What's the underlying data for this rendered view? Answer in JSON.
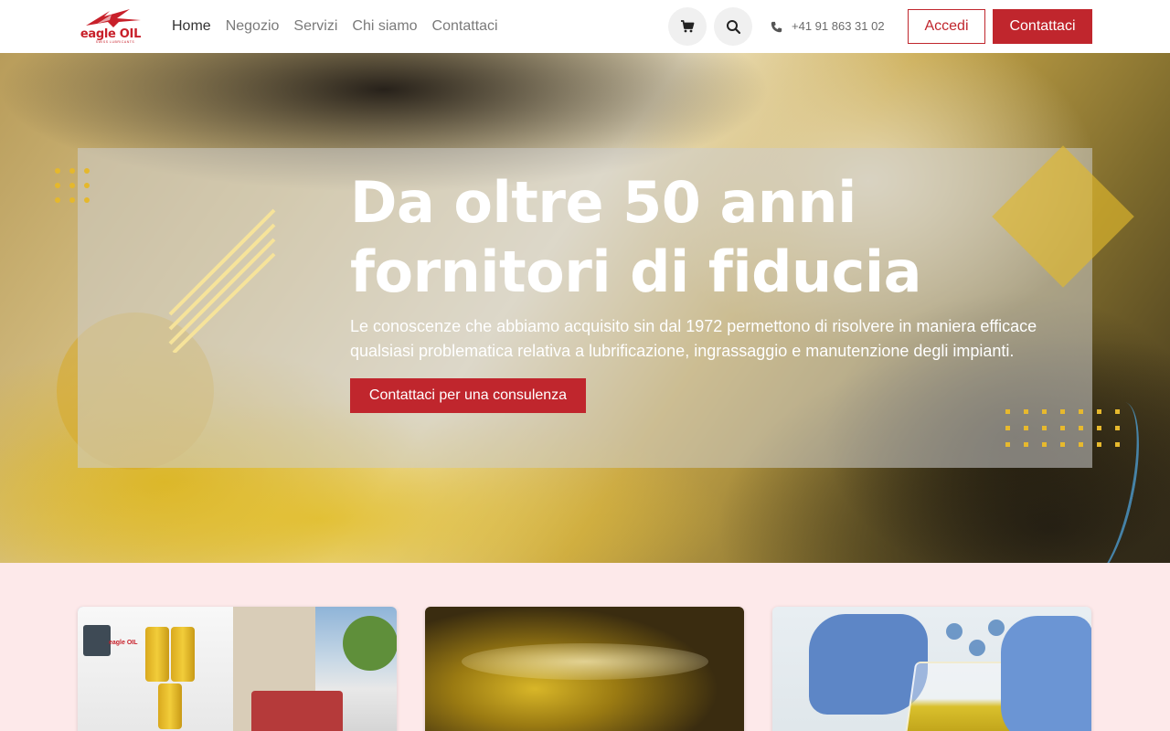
{
  "brand": {
    "name": "eagle OIL",
    "tagline": "SWISS LUBRICANTS",
    "accent": "#c0262d",
    "gold": "#e5b82c",
    "section_bg": "#fde9ea"
  },
  "nav": {
    "items": [
      {
        "label": "Home",
        "active": true
      },
      {
        "label": "Negozio",
        "active": false
      },
      {
        "label": "Servizi",
        "active": false
      },
      {
        "label": "Chi siamo",
        "active": false
      },
      {
        "label": "Contattaci",
        "active": false
      }
    ]
  },
  "header": {
    "cart_icon": "cart-icon",
    "search_icon": "search-icon",
    "phone_icon": "phone-icon",
    "phone": "+41 91 863 31 02",
    "login_label": "Accedi",
    "contact_label": "Contattaci"
  },
  "hero": {
    "title_line1": "Da oltre 50 anni",
    "title_line2": "fornitori di fiducia",
    "subtitle": "Le conoscenze che abbiamo acquisito sin dal 1972 permettono di risolvere in maniera efficace qualsiasi problematica relativa a lubrificazione, ingrassaggio e manutenzione degli impianti.",
    "cta_label": "Contattaci per una consulenza"
  },
  "cards": [
    {
      "image": "delivery-van-photo",
      "van_text": "eagle OIL"
    },
    {
      "image": "oil-texture-photo"
    },
    {
      "image": "lab-beaker-photo"
    }
  ]
}
